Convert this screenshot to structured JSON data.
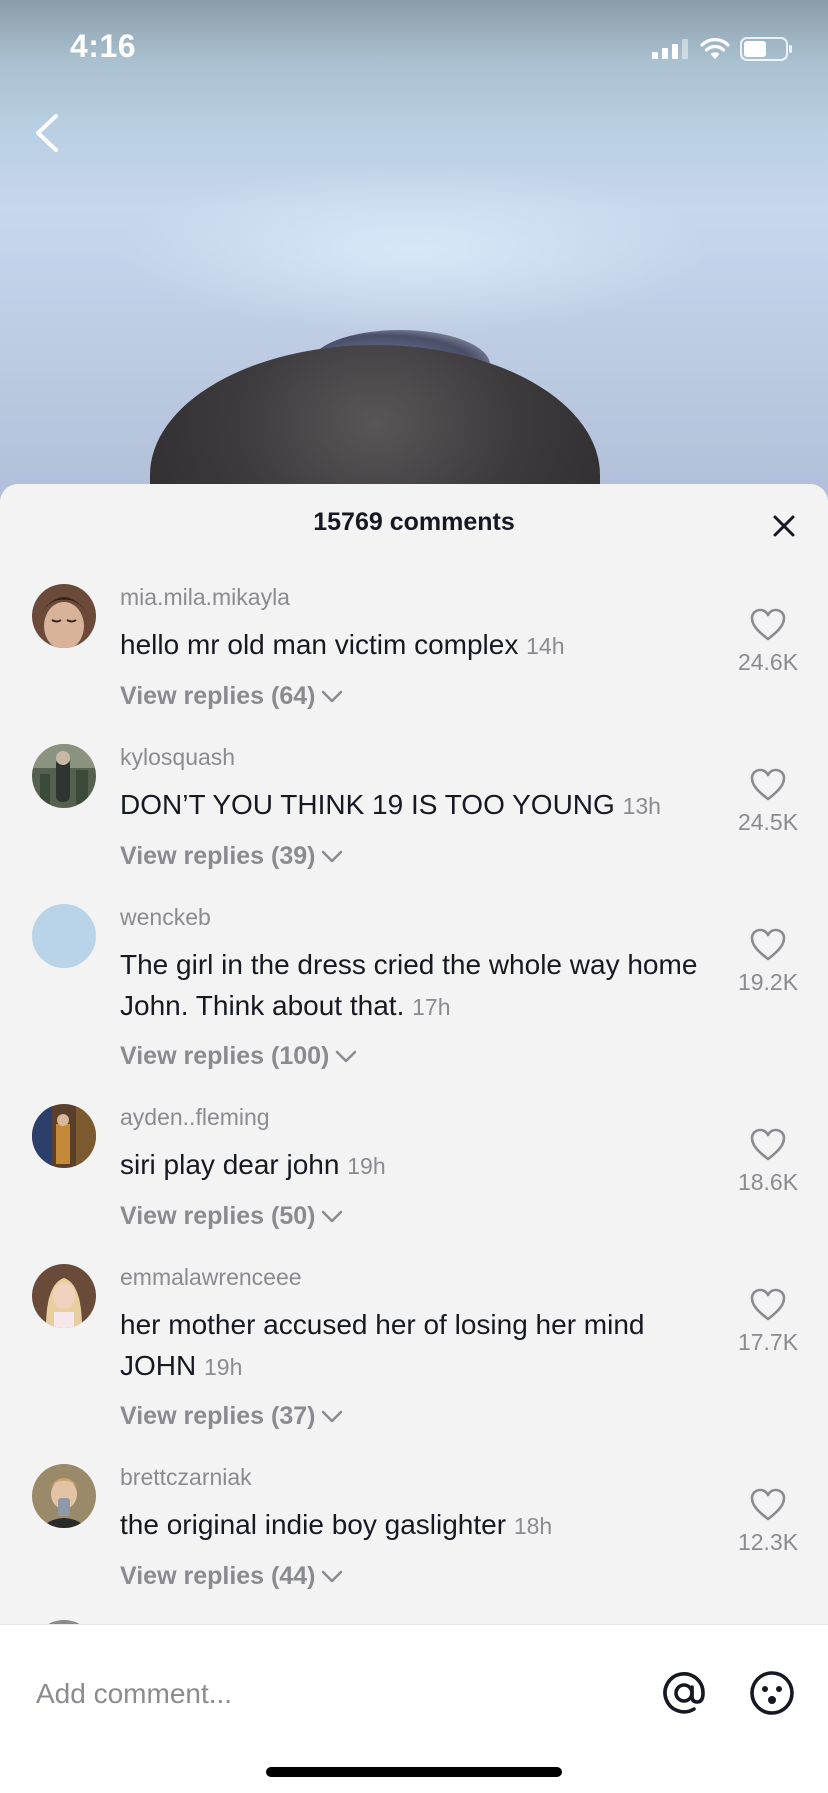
{
  "status_bar": {
    "time": "4:16"
  },
  "sheet": {
    "title": "15769 comments"
  },
  "comments": [
    {
      "username": "mia.mila.mikayla",
      "text": "hello mr old man victim complex",
      "time": "14h",
      "replies": "View replies (64)",
      "likes": "24.6K"
    },
    {
      "username": "kylosquash",
      "text": "DON’T YOU THINK 19 IS TOO YOUNG",
      "time": "13h",
      "replies": "View replies (39)",
      "likes": "24.5K"
    },
    {
      "username": "wenckeb",
      "text": "The girl in the dress cried the whole way home John. Think about that.",
      "time": "17h",
      "replies": "View replies (100)",
      "likes": "19.2K"
    },
    {
      "username": "ayden..fleming",
      "text": "siri play dear john",
      "time": "19h",
      "replies": "View replies (50)",
      "likes": "18.6K"
    },
    {
      "username": "emmalawrenceee",
      "text": "her mother accused her of losing her mind JOHN",
      "time": "19h",
      "replies": "View replies (37)",
      "likes": "17.7K"
    },
    {
      "username": "brettczarniak",
      "text": "the original indie boy gaslighter",
      "time": "18h",
      "replies": "View replies (44)",
      "likes": "12.3K"
    }
  ],
  "input": {
    "placeholder": "Add comment..."
  },
  "colors": {
    "secondary_text": "#8a8b91",
    "primary_text": "#161823",
    "sheet_bg": "#f4f3f3"
  },
  "icons": [
    "back-icon",
    "close-icon",
    "heart-icon",
    "chevron-down-icon",
    "mention-icon",
    "emoji-icon",
    "signal-icon",
    "wifi-icon",
    "battery-icon"
  ]
}
